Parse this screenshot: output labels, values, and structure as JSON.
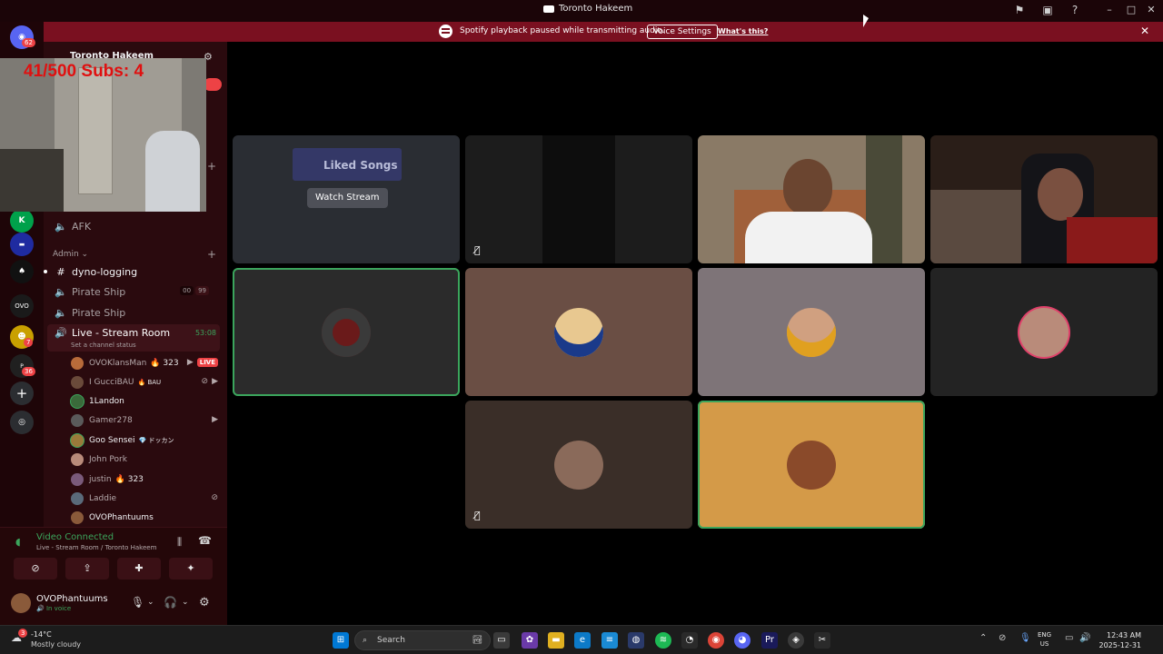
{
  "window": {
    "title": "Toronto Hakeem"
  },
  "notice": {
    "message": "Spotify playback paused while transmitting audio.",
    "voice_settings": "Voice Settings",
    "whats_this": "What's this?"
  },
  "rail": {
    "home_badge": "62",
    "badges": [
      "7",
      "36"
    ]
  },
  "overlay": {
    "subs_text": "41/500  Subs: 4"
  },
  "sidebar": {
    "server_name": "Toronto Hakeem",
    "channels_top": [
      {
        "label": "AFK",
        "icon": "speaker-icon"
      }
    ],
    "category_admin": "Admin",
    "channels": [
      {
        "label": "dyno-logging",
        "icon": "hash-icon"
      },
      {
        "label": "Pirate Ship",
        "icon": "speaker-icon",
        "counts": [
          "00",
          "99"
        ]
      },
      {
        "label": "Pirate Ship",
        "icon": "speaker-icon"
      }
    ],
    "active_channel": {
      "label": "Live - Stream Room",
      "timer": "53:08",
      "status": "Set a channel status"
    },
    "members": [
      {
        "name": "OVOKlansMan",
        "tag": "323",
        "live": "LIVE",
        "color": "#b86b3a"
      },
      {
        "name": "I GucciBAU",
        "tag": "BAU",
        "color": "#6a4a3a"
      },
      {
        "name": "1Landon",
        "tag": "",
        "color": "#3a6a3a"
      },
      {
        "name": "Gamer278",
        "tag": "",
        "color": "#5a5a5a"
      },
      {
        "name": "Goo Sensei",
        "tag": "ドッカン",
        "color": "#9a7a3a"
      },
      {
        "name": "John Pork",
        "tag": "",
        "color": "#b98b7a"
      },
      {
        "name": "justin",
        "tag": "323",
        "color": "#7a5a7a"
      },
      {
        "name": "Laddie",
        "tag": "",
        "color": "#5a6a7a"
      },
      {
        "name": "OVOPhantuums",
        "tag": "",
        "color": "#8a5a3a"
      }
    ]
  },
  "voice": {
    "status": "Video Connected",
    "location": "Live - Stream Room / Toronto Hakeem",
    "user": "OVOPhantuums",
    "user_status": "In voice"
  },
  "stage": {
    "watch_stream": "Watch Stream",
    "stream_preview_text": "Liked Songs"
  },
  "taskbar": {
    "weather_temp": "-14°C",
    "weather_desc": "Mostly cloudy",
    "search_placeholder": "Search",
    "lang_top": "ENG",
    "lang_bottom": "US",
    "time": "12:43 AM",
    "date": "2025-12-31",
    "weather_badge": "3"
  }
}
